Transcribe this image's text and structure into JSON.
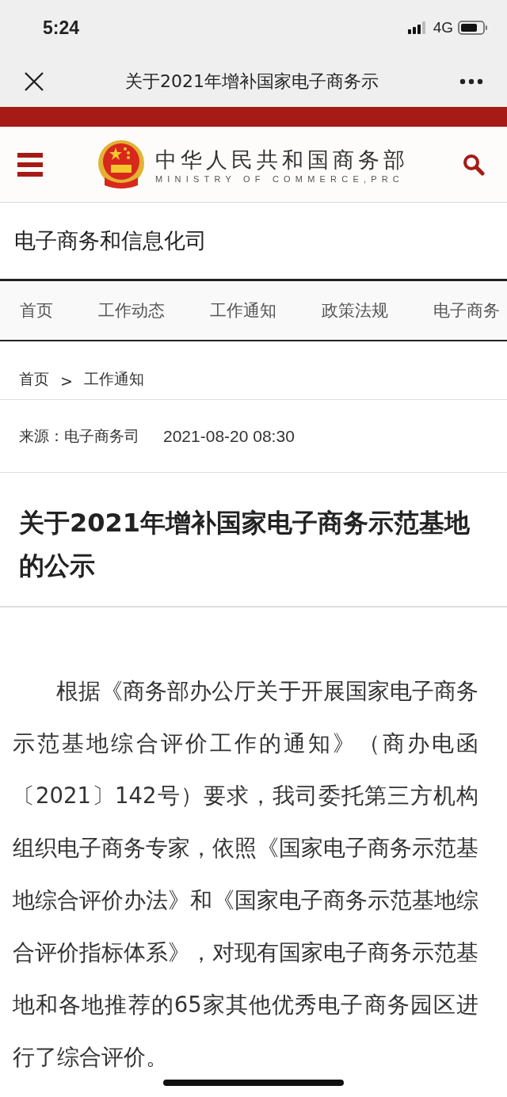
{
  "status_bar": {
    "time": "5:24",
    "network": "4G"
  },
  "browser_bar": {
    "title": "关于2021年增补国家电子商务示"
  },
  "site_header": {
    "name": "中华人民共和国商务部",
    "subtitle": "MINISTRY OF COMMERCE,PRC"
  },
  "section_title": "电子商务和信息化司",
  "nav_tabs": [
    "首页",
    "工作动态",
    "工作通知",
    "政策法规",
    "电子商务"
  ],
  "breadcrumb": {
    "items": [
      "首页",
      "工作通知"
    ],
    "separator": ">"
  },
  "meta": {
    "source_label": "来源：",
    "source": "电子商务司",
    "date": "2021-08-20 08:30"
  },
  "article": {
    "title": "关于2021年增补国家电子商务示范基地的公示",
    "paragraphs": [
      "根据《商务部办公厅关于开展国家电子商务示范基地综合评价工作的通知》（商办电函〔2021〕142号）要求，我司委托第三方机构组织电子商务专家，依照《国家电子商务示范基地综合评价办法》和《国家电子商务示范基地综合评价指标体系》，对现有国家电子商务示范基地和各地推荐的65家其他优秀电子商务园区进行了综合评价。"
    ]
  }
}
